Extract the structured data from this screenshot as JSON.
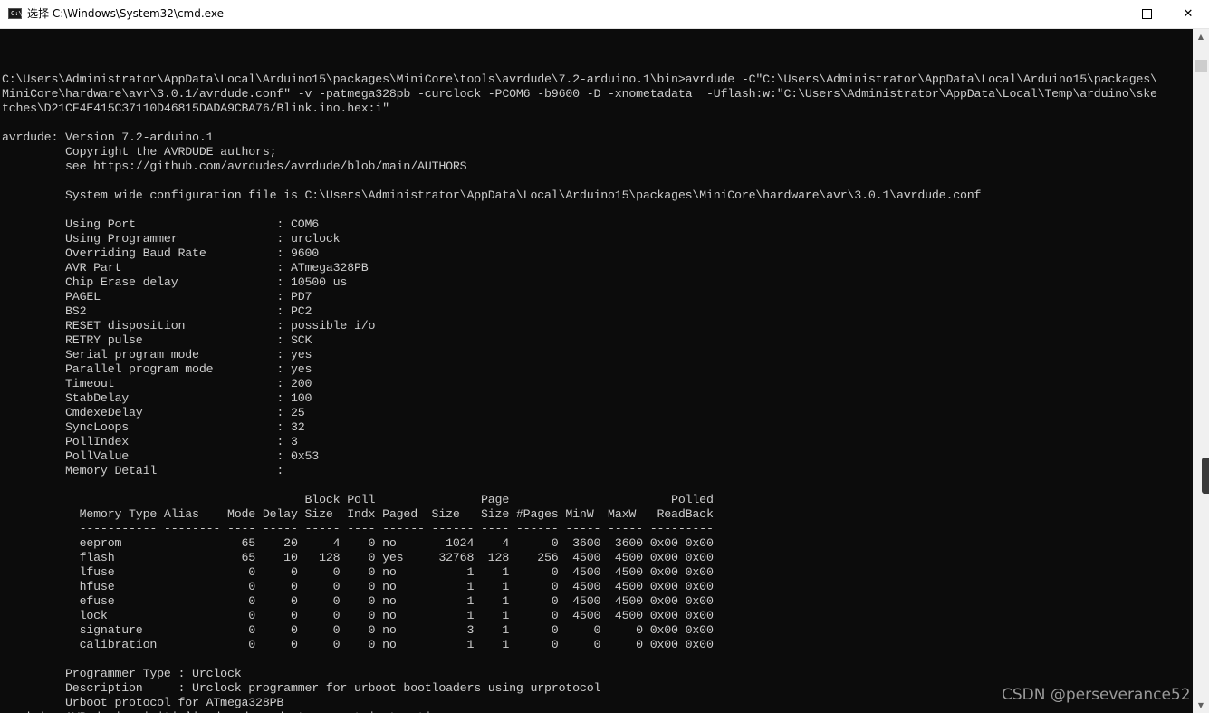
{
  "window": {
    "icon_label": "C:\\",
    "title": "选择 C:\\Windows\\System32\\cmd.exe",
    "close_glyph": "✕"
  },
  "console": {
    "lines": [
      "",
      "C:\\Users\\Administrator\\AppData\\Local\\Arduino15\\packages\\MiniCore\\tools\\avrdude\\7.2-arduino.1\\bin>avrdude -C\"C:\\Users\\Administrator\\AppData\\Local\\Arduino15\\packages\\",
      "MiniCore\\hardware\\avr\\3.0.1/avrdude.conf\" -v -patmega328pb -curclock -PCOM6 -b9600 -D -xnometadata  -Uflash:w:\"C:\\Users\\Administrator\\AppData\\Local\\Temp\\arduino\\ske",
      "tches\\D21CF4E415C37110D46815DADA9CBA76/Blink.ino.hex:i\"",
      "",
      "avrdude: Version 7.2-arduino.1",
      "         Copyright the AVRDUDE authors;",
      "         see https://github.com/avrdudes/avrdude/blob/main/AUTHORS",
      "",
      "         System wide configuration file is C:\\Users\\Administrator\\AppData\\Local\\Arduino15\\packages\\MiniCore\\hardware\\avr\\3.0.1\\avrdude.conf",
      "",
      "         Using Port                    : COM6",
      "         Using Programmer              : urclock",
      "         Overriding Baud Rate          : 9600",
      "         AVR Part                      : ATmega328PB",
      "         Chip Erase delay              : 10500 us",
      "         PAGEL                         : PD7",
      "         BS2                           : PC2",
      "         RESET disposition             : possible i/o",
      "         RETRY pulse                   : SCK",
      "         Serial program mode           : yes",
      "         Parallel program mode         : yes",
      "         Timeout                       : 200",
      "         StabDelay                     : 100",
      "         CmdexeDelay                   : 25",
      "         SyncLoops                     : 32",
      "         PollIndex                     : 3",
      "         PollValue                     : 0x53",
      "         Memory Detail                 :",
      "",
      "                                           Block Poll               Page                       Polled",
      "           Memory Type Alias    Mode Delay Size  Indx Paged  Size   Size #Pages MinW  MaxW   ReadBack",
      "           ----------- -------- ---- ----- ----- ---- ------ ------ ---- ------ ----- ----- ---------",
      "           eeprom                 65    20     4    0 no       1024    4      0  3600  3600 0x00 0x00",
      "           flash                  65    10   128    0 yes     32768  128    256  4500  4500 0x00 0x00",
      "           lfuse                   0     0     0    0 no          1    1      0  4500  4500 0x00 0x00",
      "           hfuse                   0     0     0    0 no          1    1      0  4500  4500 0x00 0x00",
      "           efuse                   0     0     0    0 no          1    1      0  4500  4500 0x00 0x00",
      "           lock                    0     0     0    0 no          1    1      0  4500  4500 0x00 0x00",
      "           signature               0     0     0    0 no          3    1      0     0     0 0x00 0x00",
      "           calibration             0     0     0    0 no          1    1      0     0     0 0x00 0x00",
      "",
      "         Programmer Type : Urclock",
      "         Description     : Urclock programmer for urboot bootloaders using urprotocol",
      "         Urboot protocol for ATmega328PB",
      "avrdude: AVR device initialized and ready to accept instructions"
    ]
  },
  "scrollbar": {
    "up_glyph": "▲",
    "down_glyph": "▼"
  },
  "watermark": "CSDN @perseverance52"
}
